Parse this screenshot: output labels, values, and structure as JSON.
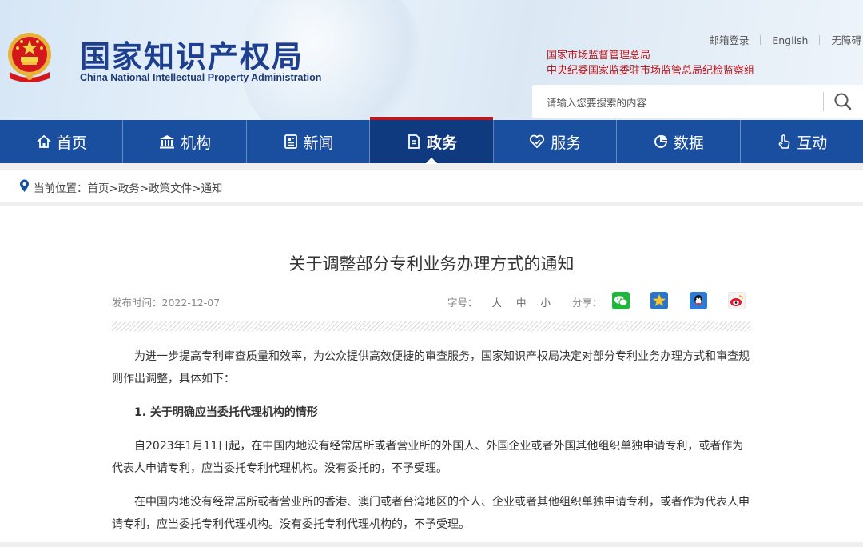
{
  "header": {
    "title": "国家知识产权局",
    "subtitle": "China National Intellectual Property Administration",
    "links": [
      "邮箱登录",
      "English",
      "无障碍"
    ],
    "orgs": [
      "国家市场监督管理总局",
      "中央纪委国家监委驻市场监管总局纪检监察组"
    ],
    "search_placeholder": "请输入您要搜索的内容"
  },
  "nav": {
    "items": [
      {
        "label": "首页",
        "icon": "home-icon"
      },
      {
        "label": "机构",
        "icon": "building-icon"
      },
      {
        "label": "新闻",
        "icon": "news-icon"
      },
      {
        "label": "政务",
        "icon": "document-icon",
        "active": true
      },
      {
        "label": "服务",
        "icon": "service-heart-icon"
      },
      {
        "label": "数据",
        "icon": "pie-chart-icon"
      },
      {
        "label": "互动",
        "icon": "hand-pointer-icon"
      }
    ],
    "accent": "#1a4e9e",
    "active_marker": "#c0161c"
  },
  "breadcrumb": {
    "prefix": "当前位置：",
    "items": [
      "首页",
      "政务",
      "政策文件",
      "通知"
    ],
    "separator": ">"
  },
  "article": {
    "title": "关于调整部分专利业务办理方式的通知",
    "date_label": "发布时间：",
    "date": "2022-12-07",
    "font_label": "字号：",
    "font_sizes": [
      "大",
      "中",
      "小"
    ],
    "share_label": "分享：",
    "share_icons": [
      "wechat-icon",
      "qzone-icon",
      "qq-icon",
      "weibo-icon"
    ],
    "paragraphs": {
      "p1": "为进一步提高专利审查质量和效率，为公众提供高效便捷的审查服务，国家知识产权局决定对部分专利业务办理方式和审查规则作出调整，具体如下：",
      "h1": "1. 关于明确应当委托代理机构的情形",
      "p2": "自2023年1月11日起，在中国内地没有经常居所或者营业所的外国人、外国企业或者外国其他组织单独申请专利，或者作为代表人申请专利，应当委托专利代理机构。没有委托的，不予受理。",
      "p3": "在中国内地没有经常居所或者营业所的香港、澳门或者台湾地区的个人、企业或者其他组织单独申请专利，或者作为代表人申请专利，应当委托专利代理机构。没有委托专利代理机构的，不予受理。"
    }
  }
}
